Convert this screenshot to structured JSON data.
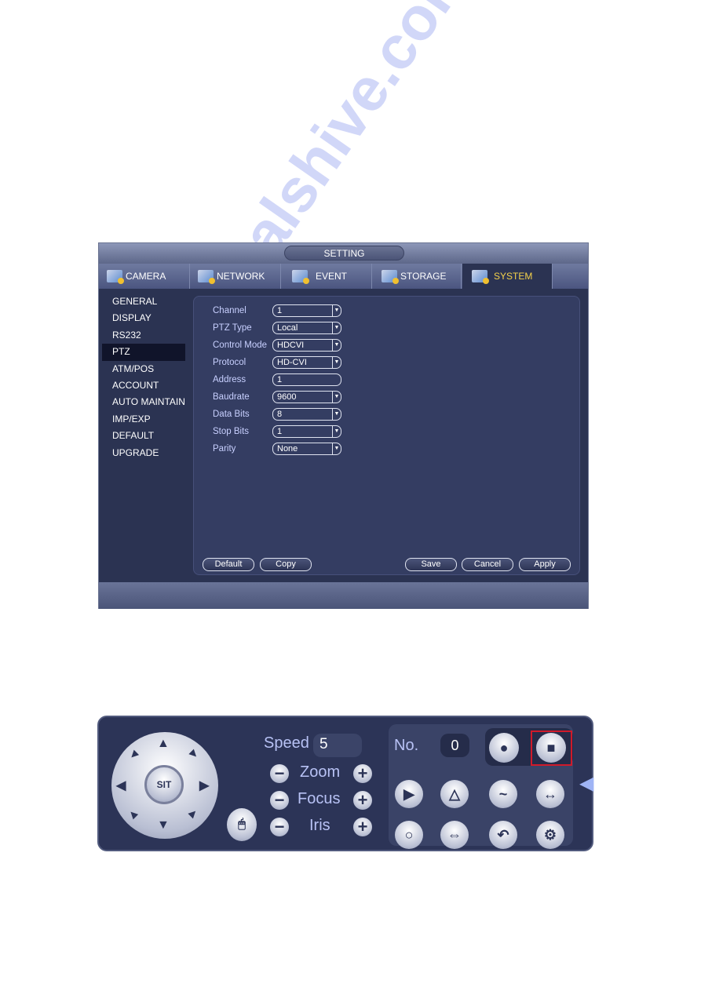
{
  "setting": {
    "title": "SETTING",
    "tabs": [
      {
        "label": "CAMERA"
      },
      {
        "label": "NETWORK"
      },
      {
        "label": "EVENT"
      },
      {
        "label": "STORAGE"
      },
      {
        "label": "SYSTEM",
        "active": true
      }
    ],
    "sidebar": [
      "GENERAL",
      "DISPLAY",
      "RS232",
      "PTZ",
      "ATM/POS",
      "ACCOUNT",
      "AUTO MAINTAIN",
      "IMP/EXP",
      "DEFAULT",
      "UPGRADE"
    ],
    "active_sidebar": "PTZ",
    "fields": [
      {
        "label": "Channel",
        "value": "1",
        "dropdown": true
      },
      {
        "label": "PTZ Type",
        "value": "Local",
        "dropdown": true
      },
      {
        "label": "Control Mode",
        "value": "HDCVI",
        "dropdown": true
      },
      {
        "label": "Protocol",
        "value": "HD-CVI",
        "dropdown": true
      },
      {
        "label": "Address",
        "value": "1",
        "dropdown": false
      },
      {
        "label": "Baudrate",
        "value": "9600",
        "dropdown": true
      },
      {
        "label": "Data Bits",
        "value": "8",
        "dropdown": true
      },
      {
        "label": "Stop Bits",
        "value": "1",
        "dropdown": true
      },
      {
        "label": "Parity",
        "value": "None",
        "dropdown": true
      }
    ],
    "buttons": {
      "default": "Default",
      "copy": "Copy",
      "save": "Save",
      "cancel": "Cancel",
      "apply": "Apply"
    },
    "active_tab_color": "#f5d24a"
  },
  "ptz": {
    "center_label": "SIT",
    "speed_label": "Speed",
    "speed_value": "5",
    "zoom_label": "Zoom",
    "focus_label": "Focus",
    "iris_label": "Iris",
    "no_label": "No.",
    "no_value": "0",
    "highlight_color": "#d01a2a"
  },
  "watermark": "manualshive.com"
}
